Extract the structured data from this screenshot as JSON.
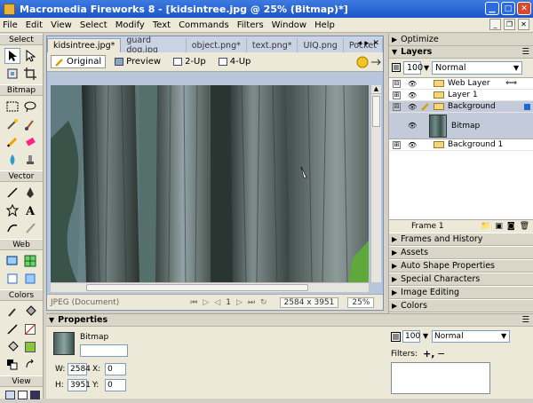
{
  "window": {
    "title": "Macromedia Fireworks 8 - [kidsintree.jpg @ 25% (Bitmap)*]"
  },
  "menu": [
    "File",
    "Edit",
    "View",
    "Select",
    "Modify",
    "Text",
    "Commands",
    "Filters",
    "Window",
    "Help"
  ],
  "tools": {
    "sections": {
      "select": "Select",
      "bitmap": "Bitmap",
      "vector": "Vector",
      "web": "Web",
      "colors": "Colors",
      "view": "View"
    }
  },
  "document": {
    "tabs": [
      "kidsintree.jpg*",
      "guard dog.jpg",
      "object.png*",
      "text.png*",
      "UIQ.png",
      "Pocket"
    ],
    "view_buttons": [
      "Original",
      "Preview",
      "2-Up",
      "4-Up"
    ],
    "status": {
      "format": "JPEG (Document)",
      "frame": "1",
      "dimensions": "2584 x 3951",
      "zoom": "25%"
    }
  },
  "panels": {
    "optimize": "Optimize",
    "layers": {
      "title": "Layers",
      "opacity": "100",
      "blend": "Normal",
      "rows": [
        "Web Layer",
        "Layer 1",
        "Background",
        "Bitmap",
        "Background 1"
      ],
      "frame_label": "Frame 1"
    },
    "collapsed": [
      "Frames and History",
      "Assets",
      "Auto Shape Properties",
      "Special Characters",
      "Image Editing",
      "Colors"
    ]
  },
  "properties": {
    "title": "Properties",
    "object_type": "Bitmap",
    "w_label": "W:",
    "w_value": "2584",
    "h_label": "H:",
    "h_value": "3951",
    "x_label": "X:",
    "x_value": "0",
    "y_label": "Y:",
    "y_value": "0",
    "opacity": "100",
    "blend": "Normal",
    "filters_label": "Filters:"
  },
  "colors": {
    "stroke": "#000000",
    "fill": "#88c640",
    "accent": "#1b55c9"
  }
}
